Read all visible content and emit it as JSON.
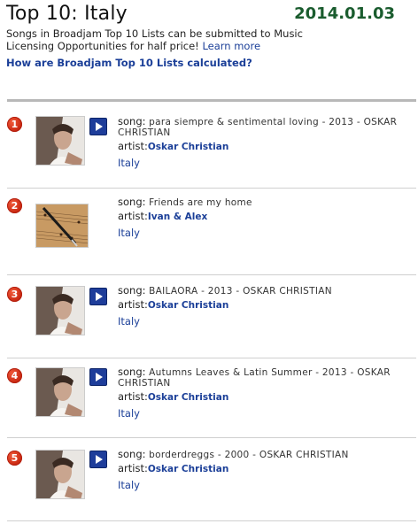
{
  "header": {
    "title": "Top 10: Italy",
    "date": "2014.01.03",
    "note_text": "Songs in Broadjam Top 10 Lists can be submitted to Music Licensing Opportunities for half price!",
    "learn_more": "Learn more",
    "calc_link": "How are Broadjam Top 10 Lists calculated?"
  },
  "labels": {
    "song": "song:",
    "artist": "artist:"
  },
  "entries": [
    {
      "rank": "1",
      "song": "para siempre & sentimental loving - 2013 - OSKAR CHRISTIAN",
      "artist": "Oskar Christian",
      "country": "Italy",
      "thumb": "portrait"
    },
    {
      "rank": "2",
      "song": "Friends are my home",
      "artist": "Ivan & Alex",
      "country": "Italy",
      "thumb": "sheet-music"
    },
    {
      "rank": "3",
      "song": "BAILAORA - 2013 - OSKAR CHRISTIAN",
      "artist": "Oskar Christian",
      "country": "Italy",
      "thumb": "portrait"
    },
    {
      "rank": "4",
      "song": "Autumns Leaves & Latin Summer - 2013 - OSKAR CHRISTIAN",
      "artist": "Oskar Christian",
      "country": "Italy",
      "thumb": "portrait"
    },
    {
      "rank": "5",
      "song": "borderdreggs - 2000 - OSKAR CHRISTIAN",
      "artist": "Oskar Christian",
      "country": "Italy",
      "thumb": "portrait"
    }
  ],
  "colors": {
    "date": "#1a5c2e",
    "link": "#1b3f98",
    "badge": "#d9361a",
    "play": "#1e3d9a"
  }
}
